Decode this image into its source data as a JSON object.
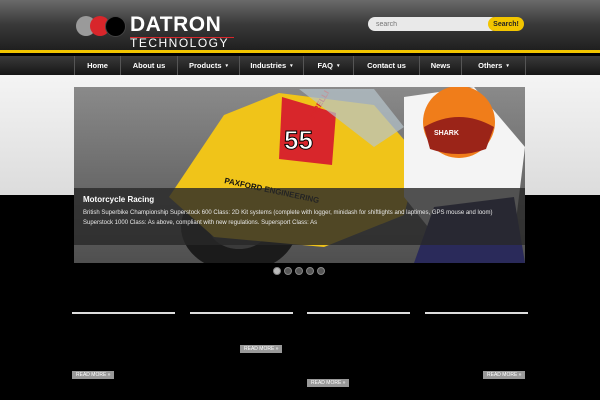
{
  "logo": {
    "name": "DATRON",
    "tagline": "TECHNOLOGY"
  },
  "search": {
    "placeholder": "search",
    "button_label": "Search!"
  },
  "nav": {
    "items": [
      {
        "label": "Home",
        "caret": ""
      },
      {
        "label": "About us",
        "caret": ""
      },
      {
        "label": "Products",
        "caret": "▾"
      },
      {
        "label": "Industries",
        "caret": "▾"
      },
      {
        "label": "FAQ",
        "caret": "▾"
      },
      {
        "label": "Contact us",
        "caret": ""
      },
      {
        "label": "News",
        "caret": ""
      },
      {
        "label": "Others",
        "caret": "▾"
      }
    ]
  },
  "slider": {
    "title": "Motorcycle Racing",
    "text": "British Superbike Championship Superstock 600 Class: 2D Kit systems (complete with logger, minidash for shiftlights and laptimes, GPS mouse and loom) Superstock 1000 Class: As above, compliant with new regulations. Supersport Class: As",
    "bike_number": "55",
    "bike_sponsor": "PAXFORD ENGINEERING",
    "fairing_brand": "PIRELLI",
    "helmet_brand": "SHARK",
    "active_slide": 1
  },
  "columns": [
    {
      "title": "",
      "text": "",
      "more": "READ MORE »"
    },
    {
      "title": "",
      "text": "",
      "more": "READ MORE »"
    },
    {
      "title": "",
      "text": "",
      "more": "READ MORE »"
    },
    {
      "title": "",
      "text": "",
      "more": "READ MORE »"
    }
  ],
  "colors": {
    "accent": "#f2c500",
    "brand_red": "#d8262b"
  }
}
